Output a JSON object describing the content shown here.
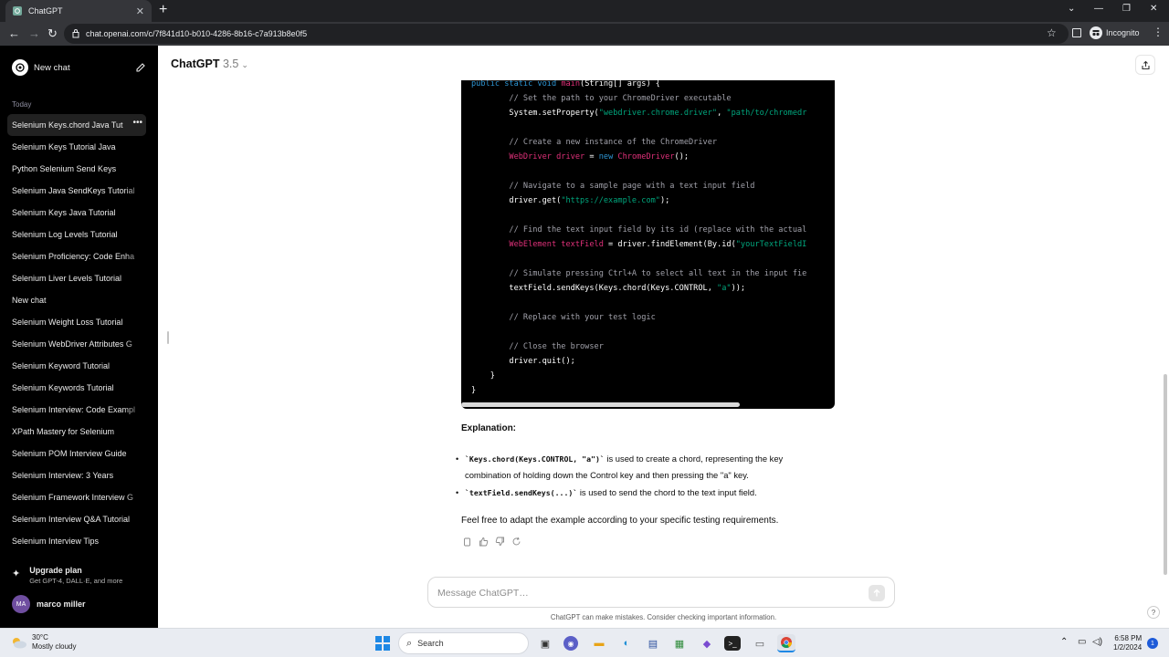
{
  "browser": {
    "tab_title": "ChatGPT",
    "url": "chat.openai.com/c/7f841d10-b010-4286-8b16-c7a913b8e0f5",
    "profile_label": "Incognito",
    "new_tab_glyph": "+",
    "tab_close_glyph": "✕",
    "window_controls": [
      "⌄",
      "—",
      "❐",
      "✕"
    ]
  },
  "sidebar": {
    "new_chat_label": "New chat",
    "section_label": "Today",
    "history": [
      {
        "label": "Selenium Keys.chord Java Tut",
        "active": true
      },
      {
        "label": "Selenium Keys Tutorial Java"
      },
      {
        "label": "Python Selenium Send Keys"
      },
      {
        "label": "Selenium Java SendKeys Tutorial"
      },
      {
        "label": "Selenium Keys Java Tutorial"
      },
      {
        "label": "Selenium Log Levels Tutorial"
      },
      {
        "label": "Selenium Proficiency: Code Enha"
      },
      {
        "label": "Selenium Liver Levels Tutorial"
      },
      {
        "label": "New chat"
      },
      {
        "label": "Selenium Weight Loss Tutorial"
      },
      {
        "label": "Selenium WebDriver Attributes G"
      },
      {
        "label": "Selenium Keyword Tutorial"
      },
      {
        "label": "Selenium Keywords Tutorial"
      },
      {
        "label": "Selenium Interview: Code Exampl"
      },
      {
        "label": "XPath Mastery for Selenium"
      },
      {
        "label": "Selenium POM Interview Guide"
      },
      {
        "label": "Selenium Interview: 3 Years"
      },
      {
        "label": "Selenium Framework Interview G"
      },
      {
        "label": "Selenium Interview Q&A Tutorial"
      },
      {
        "label": "Selenium Interview Tips"
      }
    ],
    "upgrade_title": "Upgrade plan",
    "upgrade_subtitle": "Get GPT-4, DALL·E, and more",
    "user_initials": "MA",
    "user_name": "marco miller"
  },
  "header": {
    "model_name": "ChatGPT",
    "model_version": "3.5"
  },
  "code_block": {
    "lines": [
      [
        [
          "kw",
          "public static void "
        ],
        [
          "ty",
          "main"
        ],
        [
          "",
          "(String[] args) {"
        ]
      ],
      [
        [
          "cm",
          "        // Set the path to your ChromeDriver executable"
        ]
      ],
      [
        [
          "",
          "        System.setProperty("
        ],
        [
          "st",
          "\"webdriver.chrome.driver\""
        ],
        [
          "",
          ", "
        ],
        [
          "st",
          "\"path/to/chromedr"
        ]
      ],
      [
        [
          "",
          ""
        ]
      ],
      [
        [
          "cm",
          "        // Create a new instance of the ChromeDriver"
        ]
      ],
      [
        [
          "ty",
          "        WebDriver driver"
        ],
        [
          "",
          " = "
        ],
        [
          "kw",
          "new "
        ],
        [
          "ty",
          "ChromeDriver"
        ],
        [
          "",
          "();"
        ]
      ],
      [
        [
          "",
          ""
        ]
      ],
      [
        [
          "cm",
          "        // Navigate to a sample page with a text input field"
        ]
      ],
      [
        [
          "",
          "        driver.get("
        ],
        [
          "st",
          "\"https://example.com\""
        ],
        [
          "",
          ");"
        ]
      ],
      [
        [
          "",
          ""
        ]
      ],
      [
        [
          "cm",
          "        // Find the text input field by its id (replace with the actual"
        ]
      ],
      [
        [
          "ty",
          "        WebElement textField"
        ],
        [
          "",
          " = driver.findElement(By.id("
        ],
        [
          "st",
          "\"yourTextFieldI"
        ]
      ],
      [
        [
          "",
          ""
        ]
      ],
      [
        [
          "cm",
          "        // Simulate pressing Ctrl+A to select all text in the input fie"
        ]
      ],
      [
        [
          "",
          "        textField.sendKeys(Keys.chord(Keys.CONTROL, "
        ],
        [
          "st",
          "\"a\""
        ],
        [
          "",
          "));"
        ]
      ],
      [
        [
          "",
          ""
        ]
      ],
      [
        [
          "cm",
          "        // Replace with your test logic"
        ]
      ],
      [
        [
          "",
          ""
        ]
      ],
      [
        [
          "cm",
          "        // Close the browser"
        ]
      ],
      [
        [
          "",
          "        driver.quit();"
        ]
      ],
      [
        [
          "",
          "    }"
        ]
      ],
      [
        [
          "",
          "}"
        ]
      ]
    ]
  },
  "answer": {
    "heading": "Explanation:",
    "bullet1_code": "`Keys.chord(Keys.CONTROL, \"a\")`",
    "bullet1_text_a": " is used to create a chord, representing the key",
    "bullet1_text_b": "combination of holding down the Control key and then pressing the \"a\" key.",
    "bullet2_code": "`textField.sendKeys(...)`",
    "bullet2_text": " is used to send the chord to the text input field.",
    "closing": "Feel free to adapt the example according to your specific testing requirements."
  },
  "composer": {
    "placeholder": "Message ChatGPT…",
    "disclaimer": "ChatGPT can make mistakes. Consider checking important information.",
    "help_glyph": "?"
  },
  "taskbar": {
    "temperature": "30°C",
    "weather": "Mostly cloudy",
    "search_label": "Search",
    "time": "6:58 PM",
    "date": "1/2/2024",
    "notification_count": "1"
  },
  "colors": {
    "sidebar_bg": "#000000",
    "code_bg": "#000000",
    "comment": "#a1a1aa",
    "string": "#00a67d",
    "type": "#df3079",
    "keyword": "#2e95d3"
  }
}
